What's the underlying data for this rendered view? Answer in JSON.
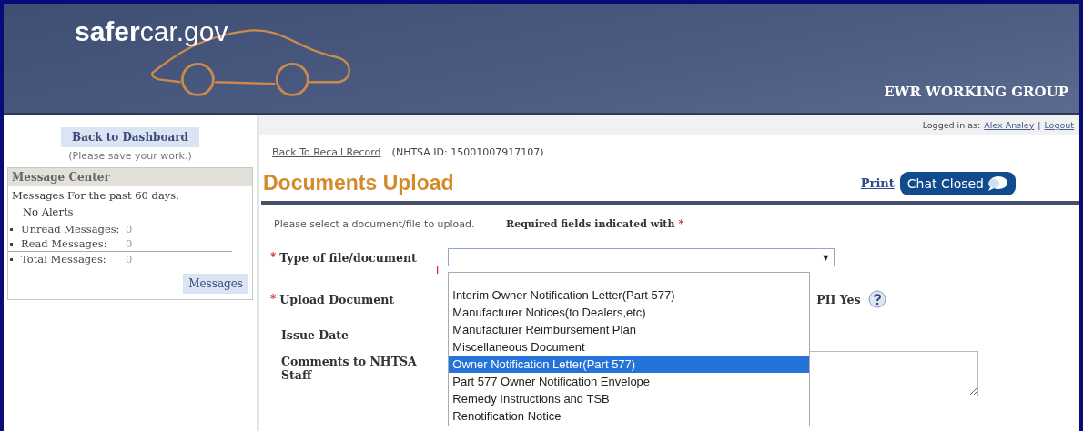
{
  "header": {
    "logo_bold": "safer",
    "logo_rest": "car.gov",
    "group": "EWR WORKING GROUP"
  },
  "user_bar": {
    "prefix": "Logged in as:",
    "user": "Alex Ansley",
    "separator": "|",
    "logout": "Logout"
  },
  "sidebar": {
    "dashboard_button": "Back to Dashboard",
    "save_note": "(Please save your work.)",
    "message_center": {
      "title": "Message Center",
      "period": "Messages For the past 60 days.",
      "alerts": "No Alerts",
      "counts": [
        {
          "label": "Unread Messages:",
          "value": "0"
        },
        {
          "label": "Read Messages:",
          "value": "0"
        },
        {
          "label": "Total Messages:",
          "value": "0"
        }
      ],
      "messages_button": "Messages"
    }
  },
  "breadcrumb": {
    "link": "Back To Recall Record",
    "id": "(NHTSA ID: 15001007917107)"
  },
  "page_title": "Documents Upload",
  "print_link": "Print",
  "chat_button": "Chat Closed",
  "instructions": "Please select a document/file to upload.",
  "required_note": "Required fields indicated with",
  "required_mark": "*",
  "form": {
    "type_label": "Type of file/document",
    "type_hint": "T",
    "upload_label": "Upload Document",
    "pii_label": "PII Yes",
    "issue_date_label": "Issue Date",
    "comments_label": "Comments to NHTSA Staff",
    "dropdown": {
      "expanded": true,
      "arrow": "▼",
      "options": [
        {
          "label": "Interim Owner Notification Letter(Part 577)",
          "selected": false
        },
        {
          "label": "Manufacturer Notices(to Dealers,etc)",
          "selected": false
        },
        {
          "label": "Manufacturer Reimbursement Plan",
          "selected": false
        },
        {
          "label": "Miscellaneous Document",
          "selected": false
        },
        {
          "label": "Owner Notification Letter(Part 577)",
          "selected": true
        },
        {
          "label": "Part 577 Owner Notification Envelope",
          "selected": false
        },
        {
          "label": "Remedy Instructions and TSB",
          "selected": false
        },
        {
          "label": "Renotification Notice",
          "selected": false
        }
      ]
    }
  }
}
